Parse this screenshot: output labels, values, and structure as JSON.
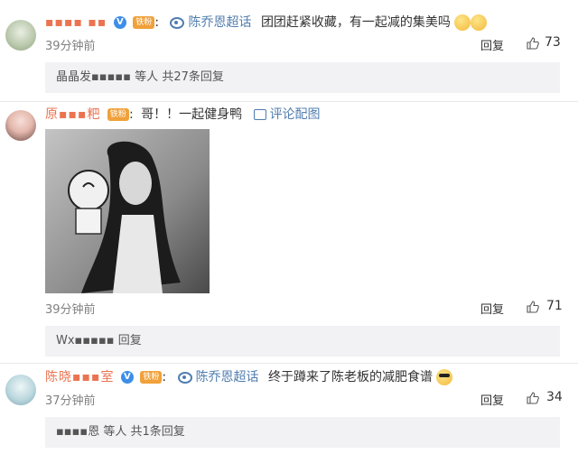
{
  "comments": [
    {
      "username": "▪▪▪▪ ▪▪",
      "topic": "陈乔恩超话",
      "text": "团团赶紧收藏，有一起减的集美吗",
      "time": "39分钟前",
      "reply_label": "回复",
      "likes": "73",
      "reply_summary": {
        "names": "晶晶发▪▪▪▪▪ 等人",
        "count": "共27条回复"
      }
    },
    {
      "username": "原▪▪▪粑",
      "text": "哥！！一起健身鸭",
      "pic_label": "评论配图",
      "time": "39分钟前",
      "reply_label": "回复",
      "likes": "71",
      "reply_summary": {
        "names": "Wx▪▪▪▪▪",
        "action": "回复"
      }
    },
    {
      "username": "陈晓▪▪▪室",
      "topic": "陈乔恩超话",
      "text": "终于蹲来了陈老板的减肥食谱",
      "time": "37分钟前",
      "reply_label": "回复",
      "likes": "34",
      "reply_summary": {
        "names": "▪▪▪▪恩 等人",
        "count": "共1条回复"
      }
    }
  ],
  "badges": {
    "fan": "铁粉",
    "v": "V"
  },
  "colors": {
    "username": "#eb7350",
    "link": "#507daf",
    "reply_bg": "#f2f2f5"
  }
}
